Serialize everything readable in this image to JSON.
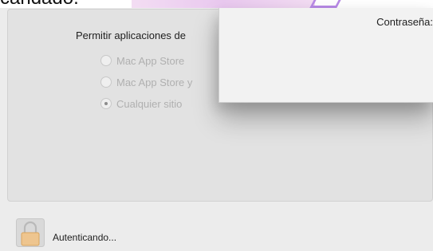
{
  "page": {
    "heading_partial": "candado."
  },
  "security": {
    "allow_label": "Permitir aplicaciones de",
    "options": [
      {
        "label": "Mac App Store",
        "selected": false
      },
      {
        "label": "Mac App Store y",
        "selected": false
      },
      {
        "label": "Cualquier sitio",
        "selected": true
      }
    ]
  },
  "auth_dialog": {
    "password_label": "Contraseña:"
  },
  "footer": {
    "status_text": "Autenticando..."
  }
}
